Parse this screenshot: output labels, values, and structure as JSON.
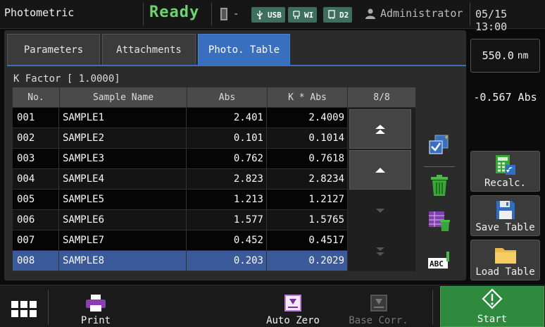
{
  "header": {
    "app_title": "Photometric",
    "status": "Ready",
    "device_dash": "-",
    "connections": [
      {
        "icon": "usb-icon",
        "label": "USB"
      },
      {
        "icon": "wifi-icon",
        "label": "WI"
      },
      {
        "icon": "drive-icon",
        "label": "D2"
      }
    ],
    "user": "Administrator",
    "datetime": "05/15 13:00"
  },
  "tabs": [
    {
      "label": "Parameters",
      "active": false
    },
    {
      "label": "Attachments",
      "active": false
    },
    {
      "label": "Photo. Table",
      "active": true
    }
  ],
  "k_factor_label": "K Factor [ 1.0000]",
  "table": {
    "columns": [
      "No.",
      "Sample Name",
      "Abs",
      "K * Abs",
      "8/8"
    ],
    "rows": [
      {
        "no": "001",
        "name": "SAMPLE1",
        "abs": "2.401",
        "kabs": "2.4009"
      },
      {
        "no": "002",
        "name": "SAMPLE2",
        "abs": "0.101",
        "kabs": "0.1014"
      },
      {
        "no": "003",
        "name": "SAMPLE3",
        "abs": "0.762",
        "kabs": "0.7618"
      },
      {
        "no": "004",
        "name": "SAMPLE4",
        "abs": "2.823",
        "kabs": "2.8234"
      },
      {
        "no": "005",
        "name": "SAMPLE5",
        "abs": "1.213",
        "kabs": "1.2127"
      },
      {
        "no": "006",
        "name": "SAMPLE6",
        "abs": "1.577",
        "kabs": "1.5765"
      },
      {
        "no": "007",
        "name": "SAMPLE7",
        "abs": "0.452",
        "kabs": "0.4517"
      },
      {
        "no": "008",
        "name": "SAMPLE8",
        "abs": "0.203",
        "kabs": "0.2029"
      }
    ],
    "selected_row": "008"
  },
  "side": {
    "wavelength_value": "550.0",
    "wavelength_unit": "nm",
    "abs_reading": "-0.567 Abs",
    "recalc_label": "Recalc.",
    "save_table_label": "Save Table",
    "load_table_label": "Load Table"
  },
  "footer": {
    "print_label": "Print",
    "auto_zero_label": "Auto Zero",
    "base_corr_label": "Base Corr.",
    "start_label": "Start"
  },
  "colors": {
    "ready": "#6ed26e",
    "active_tab": "#3a6fbf",
    "selected_row": "#3a5a99",
    "start": "#2f8a3e",
    "chip": "#3d6e5e"
  }
}
